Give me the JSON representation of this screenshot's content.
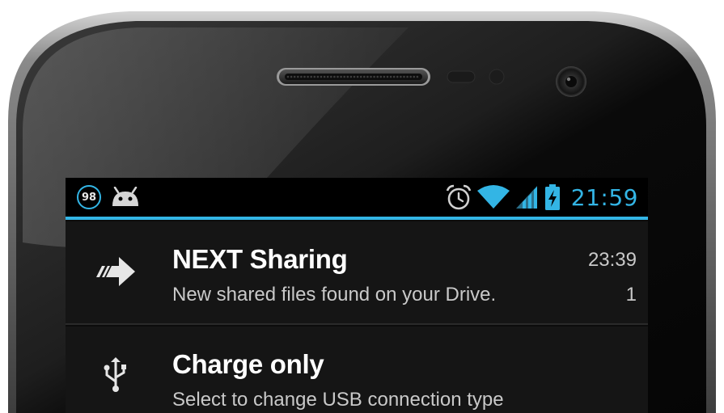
{
  "status_bar": {
    "badge_number": "98",
    "left_icons": [
      "numbered-badge-icon",
      "android-icon"
    ],
    "right_icons": [
      "alarm-clock-icon",
      "wifi-icon",
      "cell-signal-icon",
      "battery-charging-icon"
    ],
    "time": "21:59",
    "accent_color": "#33b5e5"
  },
  "notifications": [
    {
      "icon": "share-arrow-icon",
      "title": "NEXT Sharing",
      "text": "New shared files found on your Drive.",
      "time": "23:39",
      "count": "1"
    },
    {
      "icon": "usb-icon",
      "title": "Charge only",
      "text": "Select to change USB connection type"
    }
  ]
}
